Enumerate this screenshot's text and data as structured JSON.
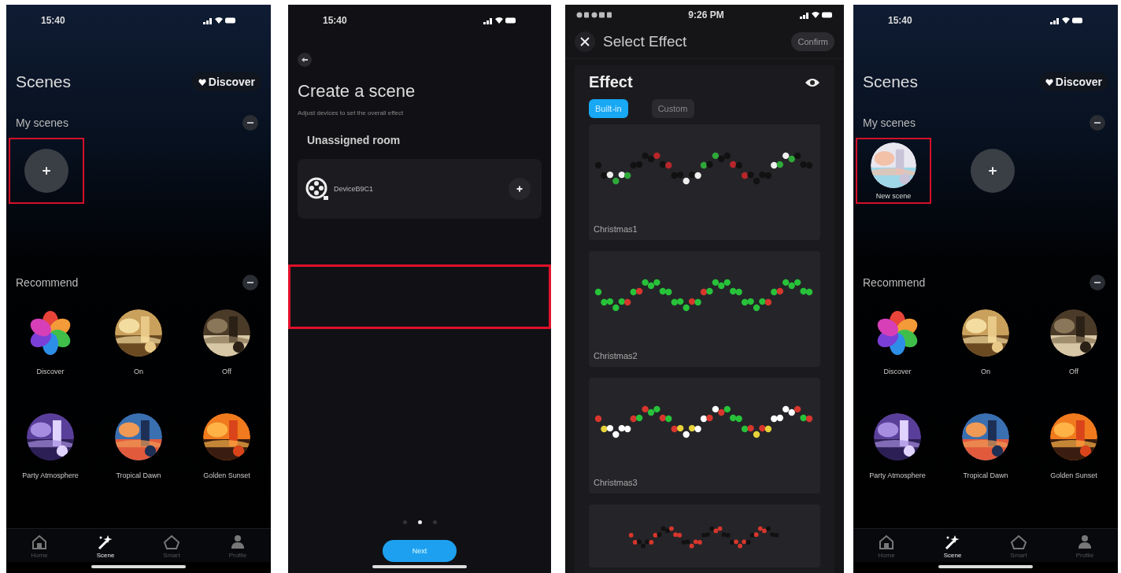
{
  "screens": [
    {
      "kind": "scenes",
      "status_time": "15:40",
      "title": "Scenes",
      "discover_button": "Discover",
      "my_scenes": {
        "heading": "My scenes",
        "items": [
          {
            "kind": "add",
            "highlighted": true
          }
        ]
      },
      "recommend": {
        "heading": "Recommend",
        "items": [
          {
            "kind": "icon",
            "label": "Discover"
          },
          {
            "kind": "picture",
            "label": "On"
          },
          {
            "kind": "picture",
            "label": "Off"
          },
          {
            "kind": "picture",
            "label": "Party Atmosphere"
          },
          {
            "kind": "picture",
            "label": "Tropical Dawn"
          },
          {
            "kind": "picture",
            "label": "Golden Sunset"
          }
        ]
      },
      "tabs": [
        {
          "label": "Home",
          "selected": false
        },
        {
          "label": "Scene",
          "selected": true
        },
        {
          "label": "Smart",
          "selected": false
        },
        {
          "label": "Profile",
          "selected": false
        }
      ]
    },
    {
      "kind": "create",
      "status_time": "15:40",
      "title": "Create a scene",
      "subtitle": "Adjust devices to set the overall effect",
      "room": "Unassigned room",
      "devices": [
        {
          "name": "DeviceB9C1"
        }
      ],
      "highlight_box": true,
      "pages": [
        {
          "selected": false
        },
        {
          "selected": true
        },
        {
          "selected": false
        }
      ],
      "next_button": "Next"
    },
    {
      "kind": "effects",
      "status_time": "9:26 PM",
      "title": "Select Effect",
      "confirm_button": "Confirm",
      "heading": "Effect",
      "tabs": [
        {
          "label": "Built-in",
          "selected": true
        },
        {
          "label": "Custom",
          "selected": false
        }
      ],
      "effects": [
        {
          "name": "Christmas1"
        },
        {
          "name": "Christmas2"
        },
        {
          "name": "Christmas3"
        },
        {
          "cut_off": true
        }
      ]
    },
    {
      "kind": "scenes",
      "status_time": "15:40",
      "title": "Scenes",
      "discover_button": "Discover",
      "my_scenes": {
        "heading": "My scenes",
        "items": [
          {
            "kind": "scene",
            "label": "New scene",
            "highlighted": true
          },
          {
            "kind": "add",
            "highlighted": false
          }
        ]
      },
      "recommend": {
        "heading": "Recommend",
        "items": [
          {
            "kind": "icon",
            "label": "Discover"
          },
          {
            "kind": "picture",
            "label": "On"
          },
          {
            "kind": "picture",
            "label": "Off"
          },
          {
            "kind": "picture",
            "label": "Party Atmosphere"
          },
          {
            "kind": "picture",
            "label": "Tropical Dawn"
          },
          {
            "kind": "picture",
            "label": "Golden Sunset"
          }
        ]
      },
      "tabs": [
        {
          "label": "Home",
          "selected": false
        },
        {
          "label": "Scene",
          "selected": true
        },
        {
          "label": "Smart",
          "selected": false
        },
        {
          "label": "Profile",
          "selected": false
        }
      ]
    }
  ]
}
